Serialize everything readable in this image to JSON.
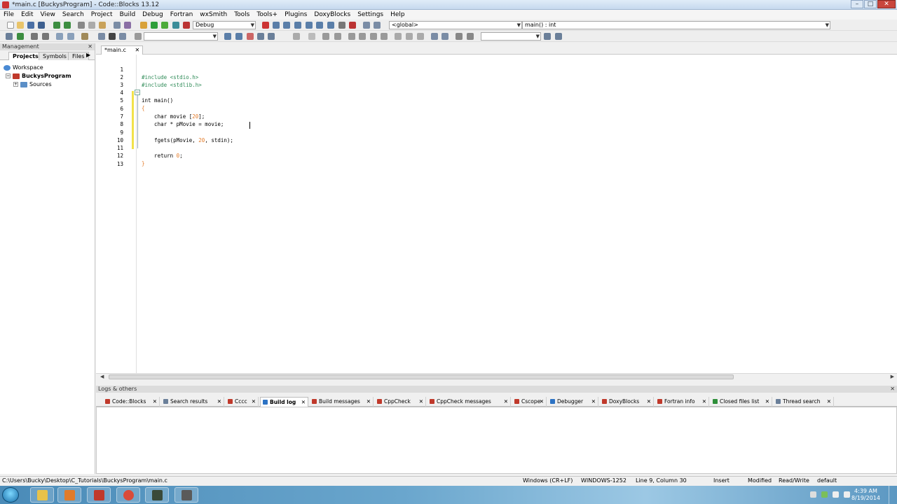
{
  "window": {
    "title": "*main.c [BuckysProgram] - Code::Blocks 13.12",
    "minimize": "–",
    "maximize": "□",
    "close": "✕"
  },
  "menu": [
    "File",
    "Edit",
    "View",
    "Search",
    "Project",
    "Build",
    "Debug",
    "Fortran",
    "wxSmith",
    "Tools",
    "Tools+",
    "Plugins",
    "DoxyBlocks",
    "Settings",
    "Help"
  ],
  "toolbar": {
    "build_target": "Debug",
    "scope": "<global>",
    "function": "main() : int"
  },
  "management": {
    "title": "Management",
    "close": "✕",
    "tabs": [
      "Projects",
      "Symbols",
      "Files"
    ],
    "active_tab": "Projects",
    "tree": {
      "workspace": "Workspace",
      "project": "BuckysProgram",
      "folder": "Sources"
    }
  },
  "editor": {
    "tab_label": "*main.c",
    "tab_close": "✕",
    "line_numbers": [
      "1",
      "2",
      "3",
      "4",
      "5",
      "6",
      "7",
      "8",
      "9",
      "10",
      "11",
      "12",
      "13"
    ],
    "cursor": {
      "line": 9,
      "column": 30
    }
  },
  "code": {
    "l1": "#include <stdio.h>",
    "l2": "#include <stdlib.h>",
    "l4": "int main()",
    "l5": "{",
    "l6a": "    char movie [",
    "l6n": "20",
    "l6b": "];",
    "l7": "    char * pMovie = movie;",
    "l9a": "    fgets(pMovie, ",
    "l9n": "20",
    "l9b": ", stdin);",
    "l11a": "    return ",
    "l11n": "0",
    "l11b": ";",
    "l12": "}"
  },
  "logs": {
    "title": "Logs & others",
    "close": "✕",
    "tabs": [
      {
        "label": "Code::Blocks",
        "color": "#c0392b"
      },
      {
        "label": "Search results",
        "color": "#6a7f99"
      },
      {
        "label": "Cccc",
        "color": "#c0392b"
      },
      {
        "label": "Build log",
        "color": "#2d73c4"
      },
      {
        "label": "Build messages",
        "color": "#c0392b"
      },
      {
        "label": "CppCheck",
        "color": "#c0392b"
      },
      {
        "label": "CppCheck messages",
        "color": "#c0392b"
      },
      {
        "label": "Cscope",
        "color": "#c0392b"
      },
      {
        "label": "Debugger",
        "color": "#2d73c4"
      },
      {
        "label": "DoxyBlocks",
        "color": "#c0392b"
      },
      {
        "label": "Fortran info",
        "color": "#c0392b"
      },
      {
        "label": "Closed files list",
        "color": "#2f8f3a"
      },
      {
        "label": "Thread search",
        "color": "#6a7f99"
      }
    ],
    "active_tab": "Build log"
  },
  "status": {
    "path": "C:\\Users\\Bucky\\Desktop\\C_Tutorials\\BuckysProgram\\main.c",
    "line_ending": "Windows (CR+LF)",
    "encoding": "WINDOWS-1252",
    "position": "Line 9, Column 30",
    "mode": "Insert",
    "modified": "Modified",
    "access": "Read/Write",
    "profile": "default"
  },
  "taskbar": {
    "time": "4:39 AM",
    "date": "8/19/2014"
  },
  "colors": {
    "accent": "#2d73c4",
    "preprocessor": "#2e8b57",
    "number": "#e37b29"
  }
}
